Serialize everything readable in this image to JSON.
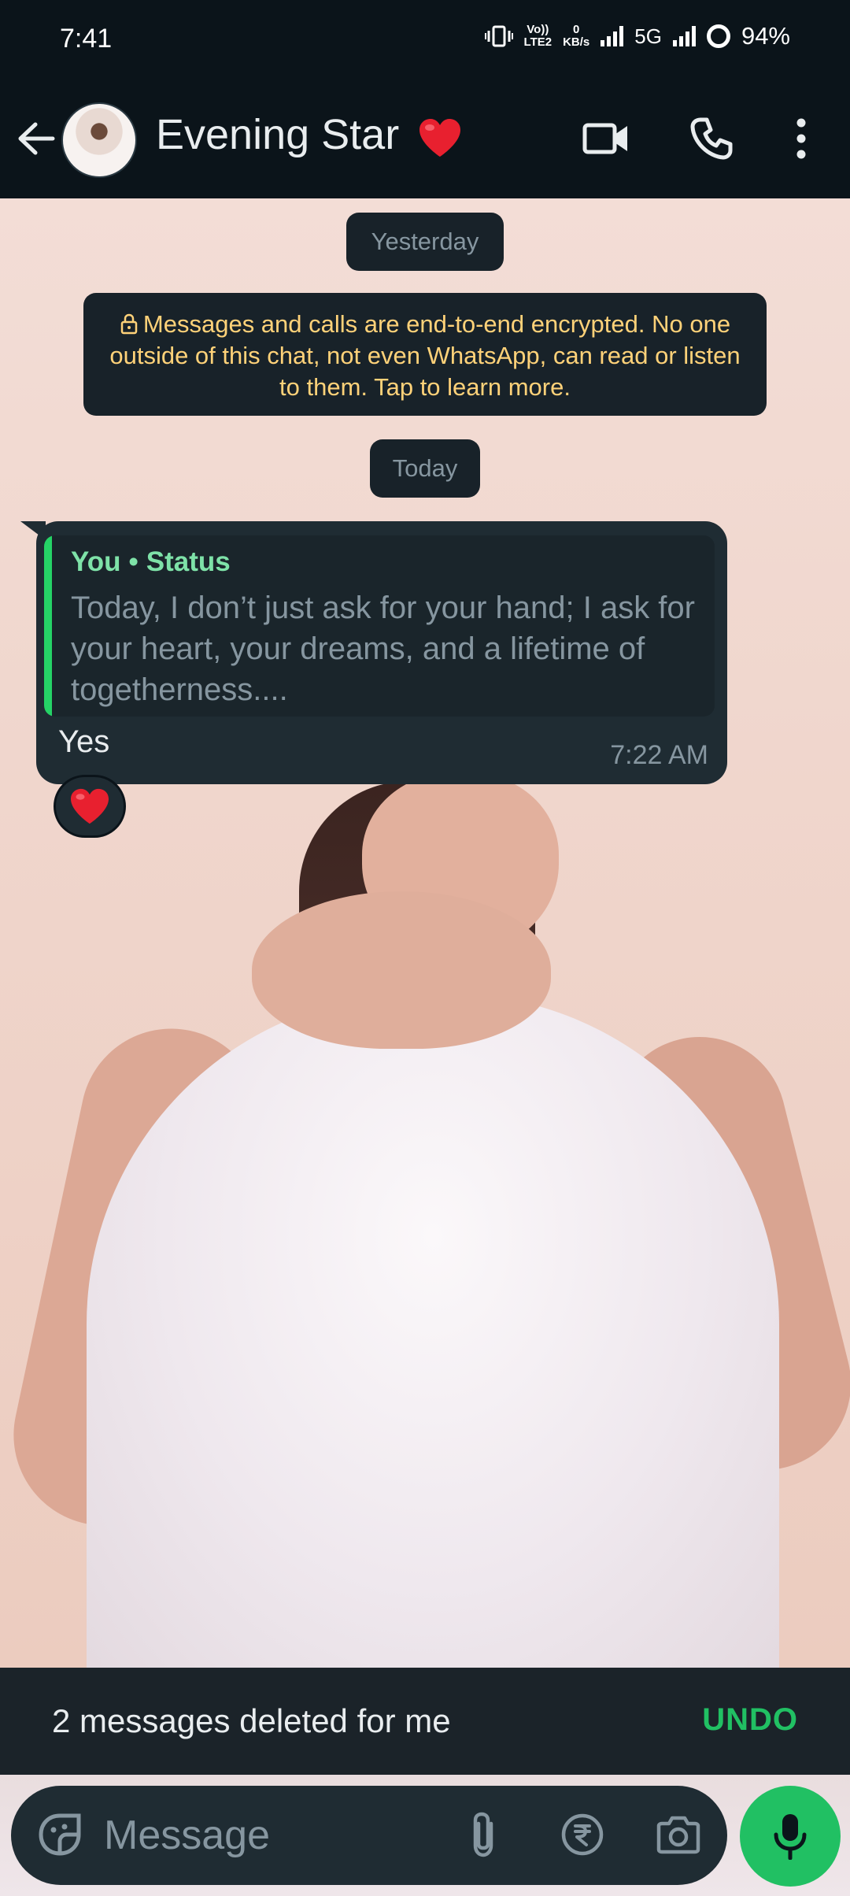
{
  "status_bar": {
    "time": "7:41",
    "volte_top": "Vo))",
    "volte_bottom": "LTE2",
    "speed_value": "0",
    "speed_unit": "KB/s",
    "network": "5G",
    "battery": "94%"
  },
  "header": {
    "contact_name": "Evening Star",
    "icons": [
      "back-arrow-icon",
      "video-call-icon",
      "phone-icon",
      "more-vert-icon",
      "heart-emoji-icon"
    ]
  },
  "chat": {
    "date_yesterday": "Yesterday",
    "encryption_notice": "Messages and calls are end-to-end encrypted. No one outside of this chat, not even WhatsApp, can read or listen to them. Tap to learn more.",
    "date_today": "Today",
    "message": {
      "quote_sender": "You",
      "quote_source": "Status",
      "quote_separator": "•",
      "quote_text": "Today, I don’t just ask for your hand; I ask for your heart, your dreams, and a lifetime of togetherness....",
      "text": "Yes",
      "time": "7:22 AM",
      "reaction": "red-heart-emoji"
    }
  },
  "snackbar": {
    "text": "2 messages deleted for me",
    "action": "UNDO"
  },
  "composer": {
    "placeholder": "Message",
    "icons": [
      "sticker-icon",
      "attach-icon",
      "rupee-payment-icon",
      "camera-icon",
      "mic-icon"
    ]
  },
  "colors": {
    "background": "#0b141a",
    "bubble": "#1f2c33",
    "accent_green": "#21c063",
    "notice_text": "#ffd279"
  }
}
